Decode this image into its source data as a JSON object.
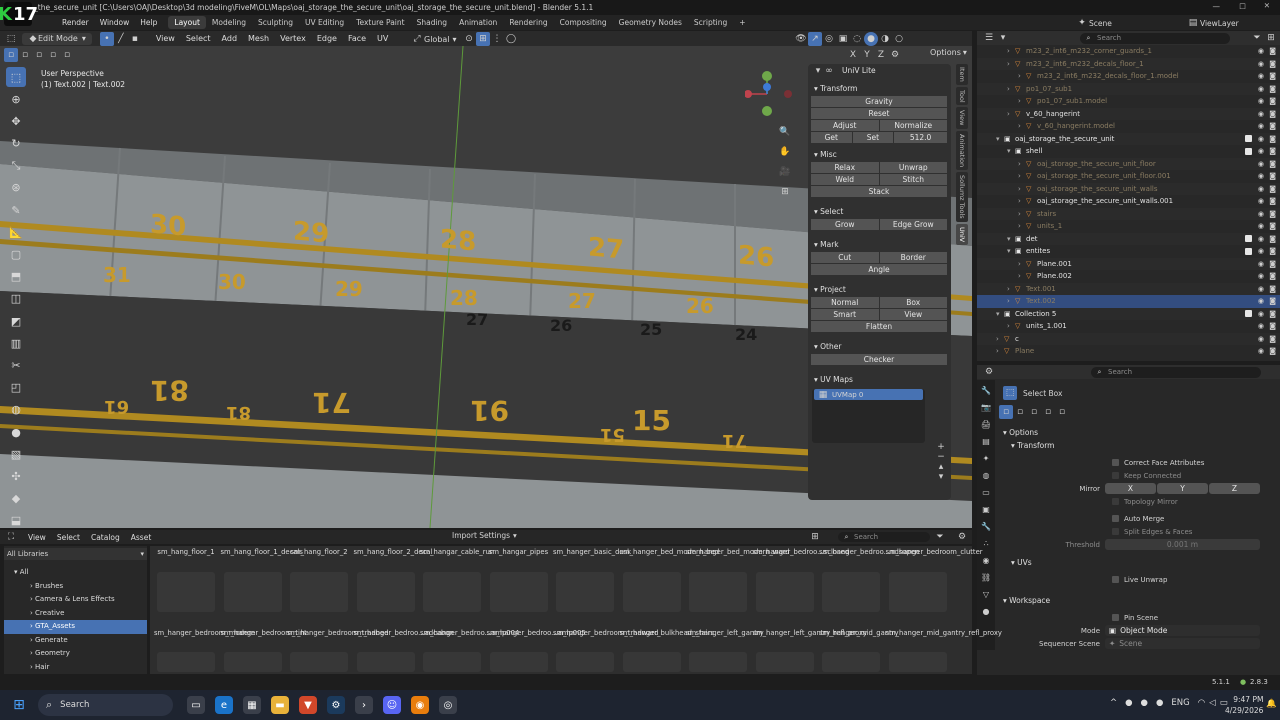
{
  "titlebar": {
    "logo_text": "17",
    "path": "_the_secure_unit [C:\\Users\\OAJ\\Desktop\\3d modeling\\FiveM\\OL\\Maps\\oaj_storage_the_secure_unit\\oaj_storage_the_secure_unit.blend] - Blender 5.1.1"
  },
  "menu": [
    "Render",
    "Window",
    "Help"
  ],
  "workspaces": [
    "Layout",
    "Modeling",
    "Sculpting",
    "UV Editing",
    "Texture Paint",
    "Shading",
    "Animation",
    "Rendering",
    "Compositing",
    "Geometry Nodes",
    "Scripting"
  ],
  "scene": {
    "scene_label": "Scene",
    "view_layer_label": "ViewLayer"
  },
  "viewport_header": {
    "mode": "Edit Mode",
    "menus": [
      "View",
      "Select",
      "Add",
      "Mesh",
      "Vertex",
      "Edge",
      "Face",
      "UV"
    ],
    "orientation": "Global",
    "options_label": "Options"
  },
  "viewport": {
    "perspective": "User Perspective",
    "object_info": "(1) Text.002 | Text.002",
    "floor_numbers": [
      "30",
      "29",
      "28",
      "27",
      "26",
      "31",
      "30",
      "29",
      "28",
      "27",
      "26",
      "27",
      "26",
      "25",
      "24",
      "81",
      "61",
      "81",
      "71",
      "91",
      "51",
      "15",
      "71"
    ]
  },
  "sidetabs": [
    "Item",
    "Tool",
    "View",
    "Animation",
    "Sollumz Tools",
    "UniV"
  ],
  "univ": {
    "title": "UniV Lite",
    "transform": {
      "title": "Transform",
      "gravity": "Gravity",
      "reset": "Reset",
      "adjust": "Adjust",
      "normalize": "Normalize",
      "get": "Get",
      "set": "Set",
      "set_value": "512.0"
    },
    "misc": {
      "title": "Misc",
      "relax": "Relax",
      "unwrap": "Unwrap",
      "weld": "Weld",
      "stitch": "Stitch",
      "stack": "Stack"
    },
    "select": {
      "title": "Select",
      "grow": "Grow",
      "edge_grow": "Edge Grow"
    },
    "mark": {
      "title": "Mark",
      "cut": "Cut",
      "border": "Border",
      "angle": "Angle"
    },
    "project": {
      "title": "Project",
      "normal": "Normal",
      "box": "Box",
      "smart": "Smart",
      "view": "View",
      "flatten": "Flatten"
    },
    "other": {
      "title": "Other",
      "checker": "Checker"
    },
    "uv_maps": {
      "title": "UV Maps",
      "items": [
        "UVMap 0"
      ]
    }
  },
  "outliner": {
    "search_placeholder": "Search",
    "rows": [
      {
        "name": "m23_2_int6_m232_corner_guards_1",
        "indent": 2,
        "dim": true
      },
      {
        "name": "m23_2_int6_m232_decals_floor_1",
        "indent": 2,
        "dim": true
      },
      {
        "name": "m23_2_int6_m232_decals_floor_1.model",
        "indent": 3,
        "dim": true
      },
      {
        "name": "po1_07_sub1",
        "indent": 2,
        "dim": true
      },
      {
        "name": "po1_07_sub1.model",
        "indent": 3,
        "dim": true
      },
      {
        "name": "v_60_hangerint",
        "indent": 2,
        "dim": false
      },
      {
        "name": "v_60_hangerint.model",
        "indent": 3,
        "dim": true
      },
      {
        "name": "oaj_storage_the_secure_unit",
        "indent": 1,
        "dim": false,
        "coll": true
      },
      {
        "name": "shell",
        "indent": 2,
        "dim": false,
        "coll": true
      },
      {
        "name": "oaj_storage_the_secure_unit_floor",
        "indent": 3,
        "dim": true
      },
      {
        "name": "oaj_storage_the_secure_unit_floor.001",
        "indent": 3,
        "dim": true
      },
      {
        "name": "oaj_storage_the_secure_unit_walls",
        "indent": 3,
        "dim": true
      },
      {
        "name": "oaj_storage_the_secure_unit_walls.001",
        "indent": 3,
        "dim": false
      },
      {
        "name": "stairs",
        "indent": 3,
        "dim": true
      },
      {
        "name": "units_1",
        "indent": 3,
        "dim": true
      },
      {
        "name": "det",
        "indent": 2,
        "dim": false,
        "coll": true
      },
      {
        "name": "entites",
        "indent": 2,
        "dim": false,
        "coll": true
      },
      {
        "name": "Plane.001",
        "indent": 3,
        "dim": false
      },
      {
        "name": "Plane.002",
        "indent": 3,
        "dim": false
      },
      {
        "name": "Text.001",
        "indent": 2,
        "dim": true
      },
      {
        "name": "Text.002",
        "indent": 2,
        "dim": true,
        "sel": true
      },
      {
        "name": "Collection 5",
        "indent": 1,
        "dim": false,
        "coll": true
      },
      {
        "name": "units_1.001",
        "indent": 2,
        "dim": false
      },
      {
        "name": "c",
        "indent": 1,
        "dim": false
      },
      {
        "name": "Plane",
        "indent": 1,
        "dim": true
      }
    ]
  },
  "properties": {
    "search_placeholder": "Search",
    "tool_name": "Select Box",
    "options": "Options",
    "transform": "Transform",
    "correct_face": "Correct Face Attributes",
    "keep_connected": "Keep Connected",
    "mirror": "Mirror",
    "mirror_axes": [
      "X",
      "Y",
      "Z"
    ],
    "topology_mirror": "Topology Mirror",
    "auto_merge": "Auto Merge",
    "split_edges": "Split Edges & Faces",
    "threshold": "Threshold",
    "threshold_value": "0.001 m",
    "uvs": "UVs",
    "live_unwrap": "Live Unwrap",
    "workspace": "Workspace",
    "pin_scene": "Pin Scene",
    "mode_label": "Mode",
    "mode_value": "Object Mode",
    "sequencer_label": "Sequencer Scene",
    "sequencer_value": "Scene"
  },
  "asset_browser": {
    "menus": [
      "View",
      "Select",
      "Catalog",
      "Asset"
    ],
    "import_settings": "Import Settings",
    "search_placeholder": "Search",
    "library": "All Libraries",
    "catalogs": [
      {
        "name": "All",
        "sel": false,
        "indent": 0
      },
      {
        "name": "Brushes",
        "sel": false,
        "indent": 1
      },
      {
        "name": "Camera & Lens Effects",
        "sel": false,
        "indent": 1
      },
      {
        "name": "Creative",
        "sel": false,
        "indent": 1
      },
      {
        "name": "GTA_Assets",
        "sel": true,
        "indent": 1
      },
      {
        "name": "Generate",
        "sel": false,
        "indent": 1
      },
      {
        "name": "Geometry",
        "sel": false,
        "indent": 1
      },
      {
        "name": "Hair",
        "sel": false,
        "indent": 1
      }
    ],
    "row1": [
      "sm_hang_floor_1",
      "sm_hang_floor_1_decals",
      "sm_hang_floor_2",
      "sm_hang_floor_2_decal",
      "sm_hangar_cable_run",
      "sm_hangar_pipes",
      "sm_hanger_basic_desk",
      "sm_hanger_bed_modern_bed",
      "sm_hanger_bed_modern_ward",
      "sm_hanger_bedroo...sclosed",
      "sm_hanger_bedroo...ndsopen",
      "sm_hanger_bedroom_clutter"
    ],
    "row2": [
      "sm_hanger_bedroom_modern",
      "sm_hanger_bedroom_tint",
      "sm_hanger_bedroom_tradbed",
      "sm_hanger_bedroo...adcabon",
      "sm_hanger_bedroo...amp004",
      "sm_hanger_bedroo...amp005",
      "sm_hanger_bedroom_tradward",
      "sm_hanger_bulkhead_stairs",
      "sm_hanger_left_gantry",
      "sm_hanger_left_gantry_refl_proxy",
      "sm_hanger_mid_gantry",
      "sm_hanger_mid_gantry_refl_proxy"
    ]
  },
  "status": {
    "version": "5.1.1",
    "value": "2.8.3"
  },
  "taskbar": {
    "search": "Search",
    "lang": "ENG",
    "time": "9:47 PM",
    "date": "4/29/2026"
  },
  "colors": {
    "accent": "#4772b3",
    "floor_number": "#c79a2c",
    "selected_row": "#334d80"
  }
}
